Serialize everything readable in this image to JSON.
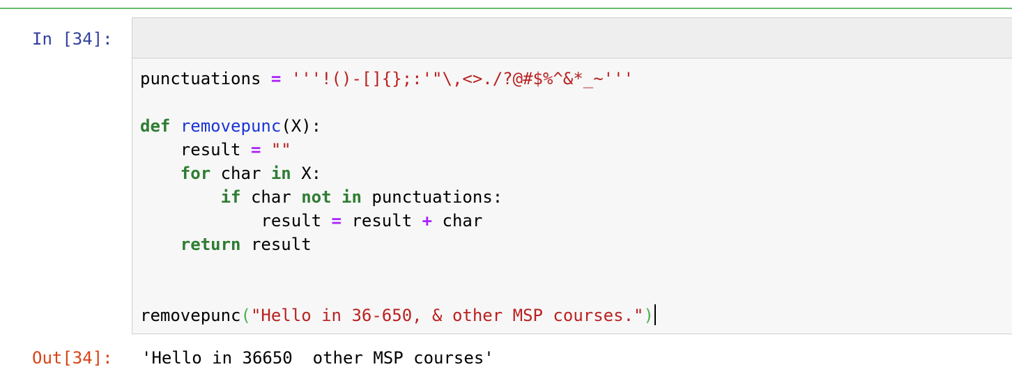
{
  "cell": {
    "in_prompt": "In [34]:",
    "out_prompt": "Out[34]:",
    "output_text": "'Hello in 36650  other MSP courses'"
  },
  "code": {
    "line1": {
      "var": "punctuations",
      "eq": "=",
      "value": "'''!()-[]{};:'\"\\,<>./?@#$%^&*_~'''"
    },
    "line2": {
      "kw_def": "def",
      "fn_name": "removepunc",
      "params": "(X):"
    },
    "line3": {
      "indent": "    ",
      "var": "result",
      "eq": "=",
      "value": "\"\""
    },
    "line4": {
      "indent": "    ",
      "kw_for": "for",
      "var": "char",
      "kw_in": "in",
      "iter": "X:"
    },
    "line5": {
      "indent": "        ",
      "kw_if": "if",
      "var": "char",
      "kw_not": "not",
      "kw_in": "in",
      "target": "punctuations:"
    },
    "line6": {
      "indent": "            ",
      "var": "result",
      "eq": "=",
      "rhs1": "result",
      "plus": "+",
      "rhs2": "char"
    },
    "line7": {
      "indent": "    ",
      "kw_return": "return",
      "var": "result"
    },
    "line8": {
      "call": "removepunc",
      "open_paren": "(",
      "arg": "\"Hello in 36-650, & other MSP courses.\"",
      "close_paren": ")"
    }
  },
  "colors": {
    "in_prompt": "#303f9f",
    "out_prompt": "#d84315",
    "keyword": "#2e7d32",
    "function_name": "#1a35d6",
    "operator": "#aa22ff",
    "string": "#ba2121",
    "cell_border_active": "#66bb6a"
  }
}
